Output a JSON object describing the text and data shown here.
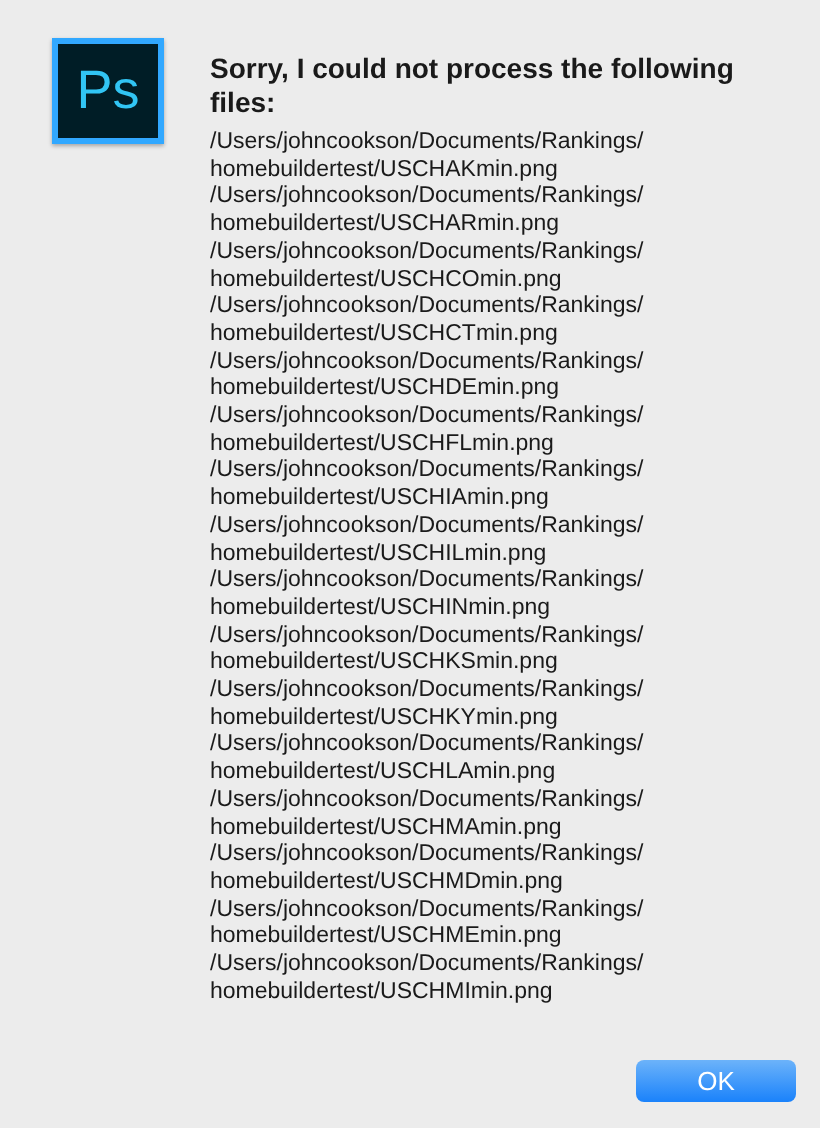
{
  "dialog": {
    "icon_text": "Ps",
    "title": "Sorry, I could not process the following files:",
    "files": [
      "/Users/johncookson/Documents/Rankings/homebuildertest/USCHAKmin.png",
      "/Users/johncookson/Documents/Rankings/homebuildertest/USCHARmin.png",
      "/Users/johncookson/Documents/Rankings/homebuildertest/USCHCOmin.png",
      "/Users/johncookson/Documents/Rankings/homebuildertest/USCHCTmin.png",
      "/Users/johncookson/Documents/Rankings/homebuildertest/USCHDEmin.png",
      "/Users/johncookson/Documents/Rankings/homebuildertest/USCHFLmin.png",
      "/Users/johncookson/Documents/Rankings/homebuildertest/USCHIAmin.png",
      "/Users/johncookson/Documents/Rankings/homebuildertest/USCHILmin.png",
      "/Users/johncookson/Documents/Rankings/homebuildertest/USCHINmin.png",
      "/Users/johncookson/Documents/Rankings/homebuildertest/USCHKSmin.png",
      "/Users/johncookson/Documents/Rankings/homebuildertest/USCHKYmin.png",
      "/Users/johncookson/Documents/Rankings/homebuildertest/USCHLAmin.png",
      "/Users/johncookson/Documents/Rankings/homebuildertest/USCHMAmin.png",
      "/Users/johncookson/Documents/Rankings/homebuildertest/USCHMDmin.png",
      "/Users/johncookson/Documents/Rankings/homebuildertest/USCHMEmin.png",
      "/Users/johncookson/Documents/Rankings/homebuildertest/USCHMImin.png"
    ],
    "button": "OK"
  }
}
